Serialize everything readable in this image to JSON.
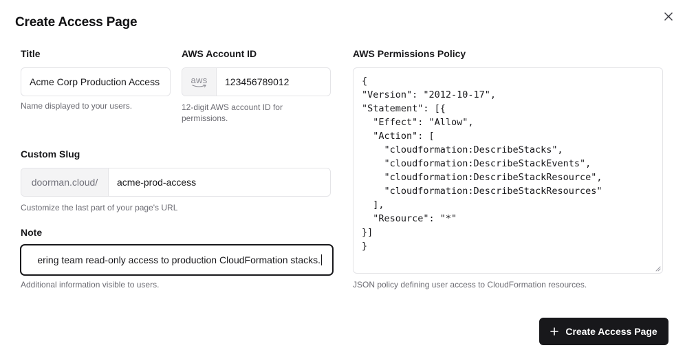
{
  "dialog": {
    "title": "Create Access Page"
  },
  "title_field": {
    "label": "Title",
    "value": "Acme Corp Production Access",
    "help": "Name displayed to your users."
  },
  "account_field": {
    "label": "AWS Account ID",
    "addon": "aws",
    "value": "123456789012",
    "help": "12-digit AWS account ID for permissions."
  },
  "slug_field": {
    "label": "Custom Slug",
    "prefix": "doorman.cloud/",
    "value": "acme-prod-access",
    "help": "Customize the last part of your page's URL"
  },
  "note_field": {
    "label": "Note",
    "value": "ering team read-only access to production CloudFormation stacks.",
    "help": "Additional information visible to users."
  },
  "policy_field": {
    "label": "AWS Permissions Policy",
    "value": "{\n\"Version\": \"2012-10-17\",\n\"Statement\": [{\n  \"Effect\": \"Allow\",\n  \"Action\": [\n    \"cloudformation:DescribeStacks\",\n    \"cloudformation:DescribeStackEvents\",\n    \"cloudformation:DescribeStackResource\",\n    \"cloudformation:DescribeStackResources\"\n  ],\n  \"Resource\": \"*\"\n}]\n}",
    "help": "JSON policy defining user access to CloudFormation resources."
  },
  "actions": {
    "create_label": "Create Access Page"
  },
  "icons": {
    "close": "close-icon",
    "plus": "plus-icon",
    "aws": "aws-logo-icon"
  },
  "colors": {
    "primary": "#18181b",
    "border": "#e4e4e7",
    "muted_text": "#6b6b72",
    "addon_bg": "#f4f4f5"
  }
}
